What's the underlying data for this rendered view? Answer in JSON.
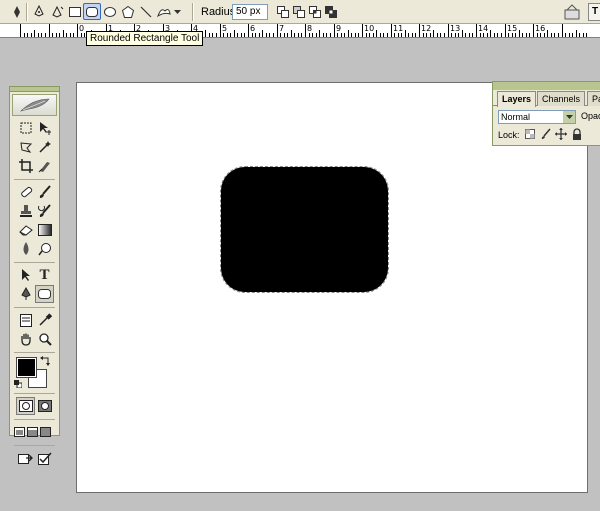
{
  "options_bar": {
    "radius_label": "Radius:",
    "radius_value": "50 px",
    "top_right_button": "T"
  },
  "tooltip": {
    "text": "Rounded Rectangle Tool"
  },
  "ruler": {
    "labels": [
      "0",
      "1",
      "2",
      "3",
      "4",
      "5",
      "6",
      "7",
      "8",
      "9",
      "10",
      "11",
      "12",
      "13",
      "14",
      "15",
      "16"
    ]
  },
  "layers_palette": {
    "tabs": [
      {
        "label": "Layers",
        "active": true
      },
      {
        "label": "Channels",
        "active": false
      },
      {
        "label": "Pa",
        "active": false
      }
    ],
    "blend_mode": "Normal",
    "opacity_label": "Opac",
    "lock_label": "Lock:"
  },
  "toolbox": {
    "foreground_color": "#000000",
    "background_color": "#ffffff",
    "selected_tool": "rounded-rectangle-tool"
  },
  "canvas": {
    "background": "#ffffff",
    "shape_fill": "#000000"
  }
}
